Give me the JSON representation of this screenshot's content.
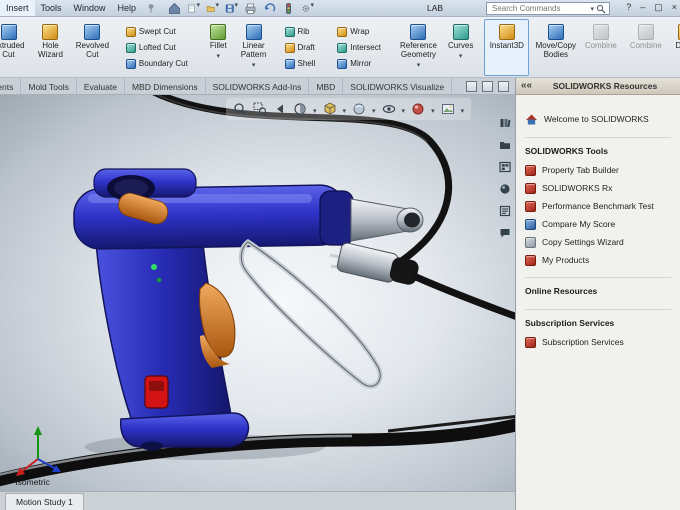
{
  "menubar": {
    "items": [
      "Insert",
      "Tools",
      "Window",
      "Help"
    ],
    "lab_label": "LAB",
    "search_placeholder": "Search Commands",
    "controls": {
      "help": "?",
      "min": "–",
      "max": "▢",
      "close": "×"
    }
  },
  "ribbon": {
    "large": [
      {
        "label": "Extruded Cut"
      },
      {
        "label": "Hole Wizard"
      },
      {
        "label": "Revolved Cut"
      },
      {
        "label": "Fillet"
      },
      {
        "label": "Linear Pattern"
      },
      {
        "label": "Reference Geometry"
      },
      {
        "label": "Curves"
      },
      {
        "label": "Instant3D"
      },
      {
        "label": "Move/Copy Bodies"
      },
      {
        "label": "Combine"
      },
      {
        "label": "Combine"
      },
      {
        "label": "Dome"
      }
    ],
    "small_stacks": [
      [
        "Swept Cut",
        "Lofted Cut",
        "Boundary Cut"
      ],
      [
        "Rib",
        "Draft",
        "Shell"
      ],
      [
        "Wrap",
        "Intersect",
        "Mirror"
      ]
    ]
  },
  "tabs": [
    "Weldments",
    "Mold Tools",
    "Evaluate",
    "MBD Dimensions",
    "SOLIDWORKS Add-Ins",
    "MBD",
    "SOLIDWORKS Visualize"
  ],
  "viewport": {
    "view_label": "*Isometric"
  },
  "taskpane": {
    "collapse": "««",
    "title": "SOLIDWORKS Resources",
    "welcome": "Welcome to SOLIDWORKS",
    "sections": {
      "tools": {
        "header": "SOLIDWORKS Tools",
        "items": [
          "Property Tab Builder",
          "SOLIDWORKS Rx",
          "Performance Benchmark Test",
          "Compare My Score",
          "Copy Settings Wizard",
          "My Products"
        ]
      },
      "online": {
        "header": "Online Resources"
      },
      "subscription": {
        "header": "Subscription Services",
        "item": "Subscription Services"
      }
    }
  },
  "motionbar": {
    "tab": "Motion Study 1"
  },
  "colors": {
    "gun_body": "#2f33c9",
    "trigger_orange": "#d97a2e",
    "selection_accent": "#6ba3d6",
    "cable_black": "#141414"
  }
}
